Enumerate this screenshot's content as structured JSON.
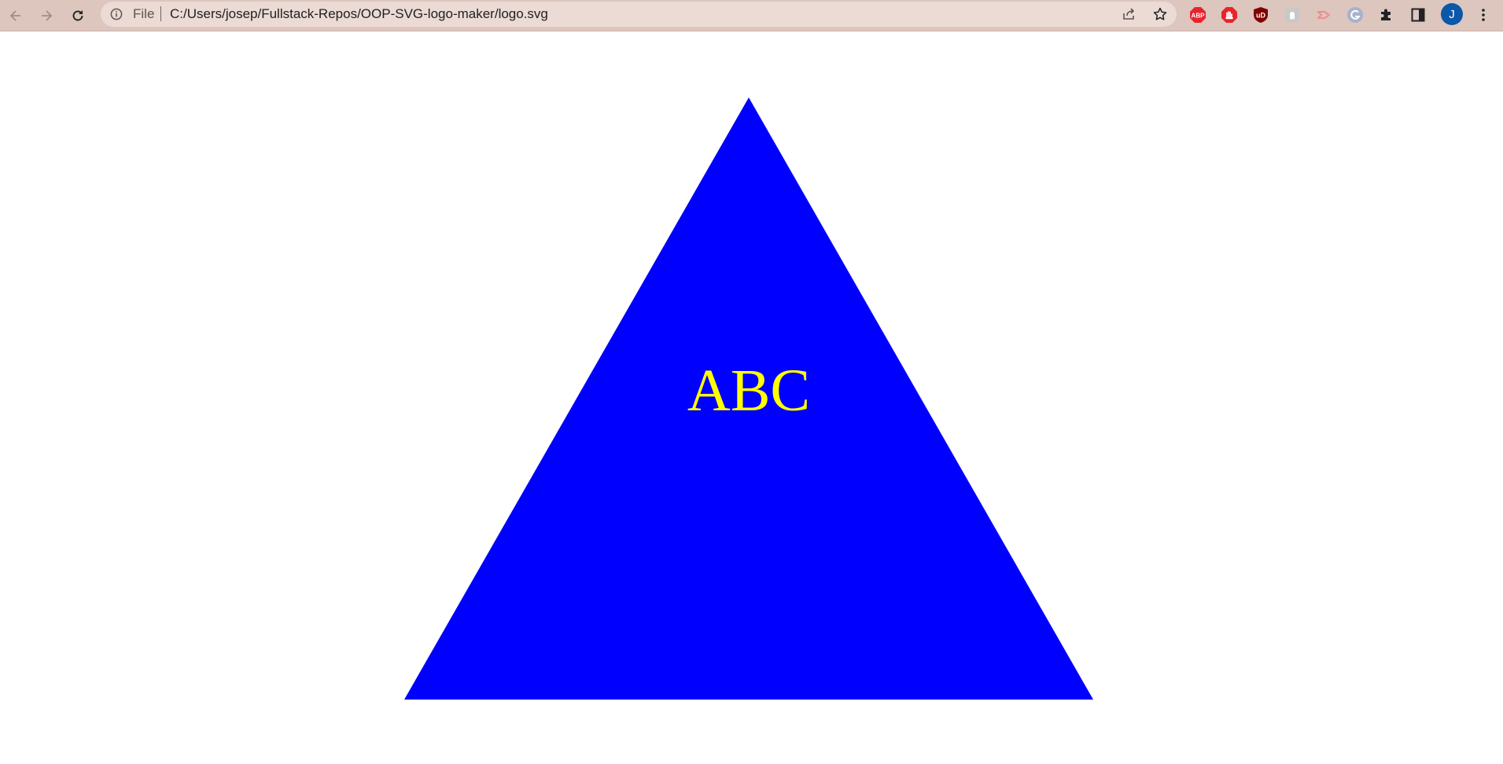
{
  "browser": {
    "scheme_label": "File",
    "url": "C:/Users/josep/Fullstack-Repos/OOP-SVG-logo-maker/logo.svg",
    "avatar_initial": "J",
    "toolbar_color": "#dcc6be",
    "icons": {
      "back": "back-arrow-icon",
      "forward": "forward-arrow-icon",
      "reload": "reload-icon",
      "info": "info-icon",
      "share": "share-icon",
      "bookmark": "star-icon",
      "extensions": "puzzle-icon",
      "side_panel": "side-panel-icon",
      "menu": "kebab-menu-icon"
    },
    "extensions": [
      {
        "name": "adblock-plus-icon",
        "label": "ABP",
        "color": "#e8232d"
      },
      {
        "name": "adblock-hand-icon",
        "label": "",
        "color": "#e8232d"
      },
      {
        "name": "ublock-origin-icon",
        "label": "uD",
        "color": "#800000"
      },
      {
        "name": "extension-ghost-icon",
        "label": "",
        "color": "#b0b0b0"
      },
      {
        "name": "extension-arrow-icon",
        "label": "",
        "color": "#f59a9a"
      },
      {
        "name": "grammarly-icon",
        "label": "",
        "color": "#9aa8c8"
      }
    ]
  },
  "logo": {
    "shape": "triangle",
    "shape_color": "#0000ff",
    "text": "ABC",
    "text_color": "#ffff00"
  }
}
